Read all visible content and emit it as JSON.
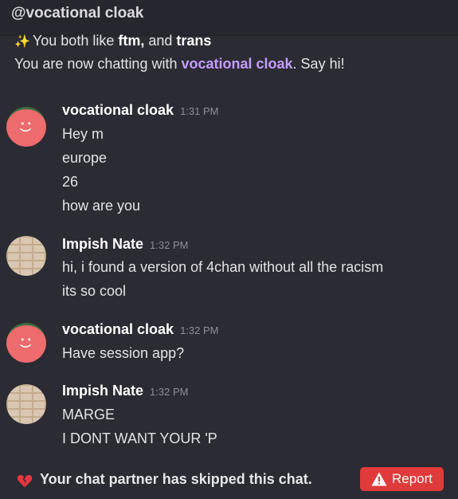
{
  "header": {
    "title": "@vocational cloak"
  },
  "shared_interests": {
    "prefix": "You both like ",
    "interest_1": "ftm,",
    "joiner": " and ",
    "interest_2": "trans"
  },
  "chat_intro": {
    "prefix": "You are now chatting with ",
    "partner": "vocational cloak",
    "suffix": ". Say hi!"
  },
  "messages": [
    {
      "author": "vocational cloak",
      "time": "1:31 PM",
      "lines": [
        "Hey m",
        "europe",
        "26",
        "how are you"
      ]
    },
    {
      "author": "Impish Nate",
      "time": "1:32 PM",
      "lines": [
        "hi, i found a version of 4chan without all the racism",
        "its so cool"
      ]
    },
    {
      "author": "vocational cloak",
      "time": "1:32 PM",
      "lines": [
        "Have session app?"
      ]
    },
    {
      "author": "Impish Nate",
      "time": "1:32 PM",
      "lines": [
        "MARGE",
        "I DONT WANT YOUR 'P"
      ]
    }
  ],
  "footer": {
    "skip_text": "Your chat partner has skipped this chat.",
    "report_label": "Report"
  },
  "icons": {
    "sparkle": "sparkle-icon",
    "broken_heart": "broken-heart-icon",
    "warning": "warning-icon"
  },
  "colors": {
    "background": "#2b2b34",
    "partner_name": "#c59cff",
    "report_button": "#e03a3a",
    "avatar_red": "#ee6b6e"
  }
}
